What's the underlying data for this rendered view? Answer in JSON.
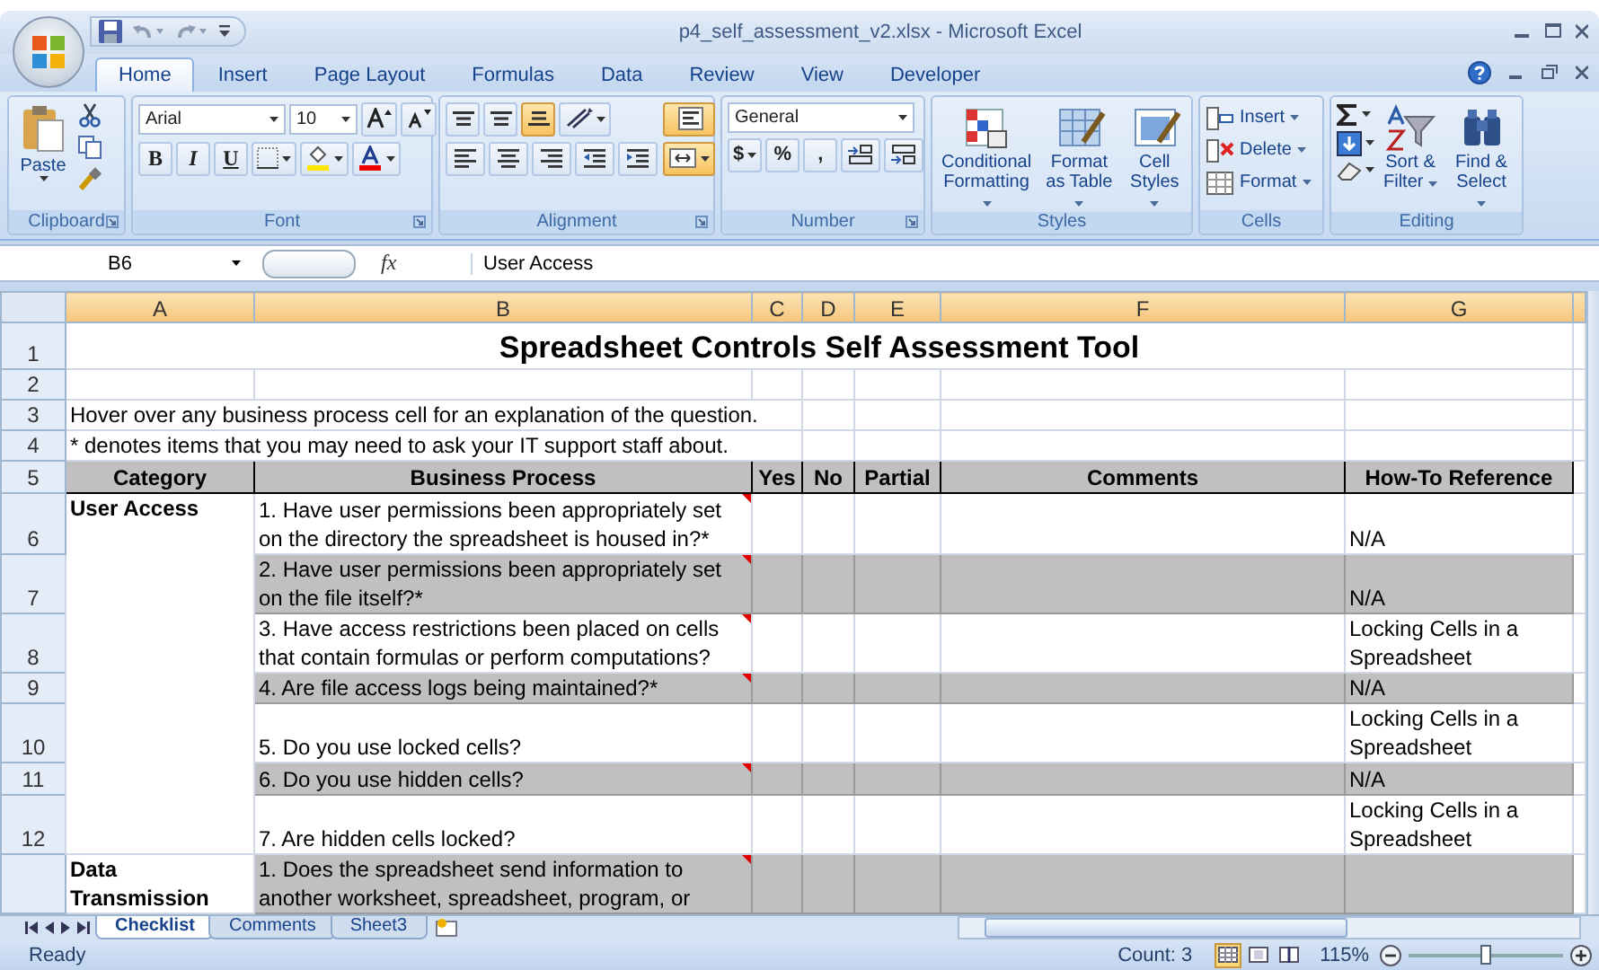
{
  "title_bar": {
    "title": "p4_self_assessment_v2.xlsx - Microsoft Excel"
  },
  "ribbon_tabs": [
    {
      "label": "Home",
      "selected": true
    },
    {
      "label": "Insert",
      "selected": false
    },
    {
      "label": "Page Layout",
      "selected": false
    },
    {
      "label": "Formulas",
      "selected": false
    },
    {
      "label": "Data",
      "selected": false
    },
    {
      "label": "Review",
      "selected": false
    },
    {
      "label": "View",
      "selected": false
    },
    {
      "label": "Developer",
      "selected": false
    }
  ],
  "clipboard": {
    "label": "Clipboard",
    "paste": "Paste"
  },
  "font": {
    "label": "Font",
    "name": "Arial",
    "size": "10",
    "buttons": [
      {
        "kind": "bold",
        "text": "B"
      },
      {
        "kind": "italic",
        "text": "I"
      },
      {
        "kind": "underline",
        "text": "U"
      }
    ]
  },
  "alignment": {
    "label": "Alignment",
    "buttons": [
      {
        "kind": "align-top",
        "selected": false
      },
      {
        "kind": "align-middle",
        "selected": false
      },
      {
        "kind": "align-bottom",
        "selected": true
      },
      {
        "kind": "orientation",
        "selected": false
      },
      {
        "kind": "wrap-text",
        "selected": true
      },
      {
        "kind": "align-left",
        "selected": false
      },
      {
        "kind": "align-center",
        "selected": false
      },
      {
        "kind": "align-right",
        "selected": false
      },
      {
        "kind": "decrease-indent",
        "selected": false
      },
      {
        "kind": "increase-indent",
        "selected": false
      },
      {
        "kind": "merge-center",
        "selected": true
      }
    ]
  },
  "number": {
    "label": "Number",
    "format": "General",
    "symbols": [
      "$",
      "%",
      ","
    ]
  },
  "styles": {
    "label": "Styles",
    "buttons": [
      {
        "kind": "conditional",
        "lines": [
          "Conditional",
          "Formatting"
        ]
      },
      {
        "kind": "table",
        "lines": [
          "Format",
          "as Table"
        ]
      },
      {
        "kind": "cell-styles",
        "lines": [
          "Cell",
          "Styles"
        ]
      }
    ]
  },
  "cells": {
    "label": "Cells",
    "buttons": [
      {
        "kind": "insert",
        "text": "Insert"
      },
      {
        "kind": "delete",
        "text": "Delete"
      },
      {
        "kind": "format",
        "text": "Format"
      }
    ]
  },
  "editing": {
    "label": "Editing",
    "buttons": [
      {
        "kind": "sort",
        "lines": [
          "Sort &",
          "Filter"
        ]
      },
      {
        "kind": "find",
        "lines": [
          "Find &",
          "Select"
        ]
      }
    ]
  },
  "formula_bar": {
    "cell_ref": "B6",
    "function_label": "fx",
    "value": "User Access"
  },
  "columns": [
    "A",
    "B",
    "C",
    "D",
    "E",
    "F",
    "G"
  ],
  "rows": [
    {
      "number": "1",
      "kind": "title",
      "text": "Spreadsheet Controls Self Assessment Tool"
    },
    {
      "number": "2",
      "kind": "blank"
    },
    {
      "number": "3",
      "kind": "note",
      "text": "Hover over any business process cell for an explanation of the question."
    },
    {
      "number": "4",
      "kind": "note",
      "text": "* denotes items that you may need to ask your IT support staff about."
    },
    {
      "number": "5",
      "kind": "header",
      "cells": [
        "Category",
        "Business Process",
        "Yes",
        "No",
        "Partial",
        "Comments",
        "How-To Reference"
      ]
    },
    {
      "number": "6",
      "kind": "item",
      "category": "User Access",
      "process": "1. Have user permissions been appropriately set on the directory the spreadsheet is housed in?*",
      "comment": true,
      "shaded": false,
      "reference": "N/A"
    },
    {
      "number": "7",
      "kind": "item",
      "process": "2. Have user permissions been appropriately set on the file itself?*",
      "comment": true,
      "shaded": true,
      "reference": "N/A"
    },
    {
      "number": "8",
      "kind": "item",
      "process": "3. Have access restrictions been placed on cells that contain formulas or perform computations?",
      "comment": true,
      "shaded": false,
      "reference": "Locking Cells in a Spreadsheet"
    },
    {
      "number": "9",
      "kind": "item",
      "process": "4. Are file access logs being maintained?*",
      "comment": true,
      "shaded": true,
      "reference": "N/A"
    },
    {
      "number": "10",
      "kind": "item",
      "process": "5. Do you use locked cells?",
      "comment": false,
      "shaded": false,
      "reference": "Locking Cells in a Spreadsheet"
    },
    {
      "number": "11",
      "kind": "item",
      "process": "6. Do you use hidden cells?",
      "comment": true,
      "shaded": true,
      "reference": "N/A"
    },
    {
      "number": "12",
      "kind": "item",
      "process": "7. Are hidden cells locked?",
      "comment": false,
      "shaded": false,
      "reference": "Locking Cells in a Spreadsheet"
    },
    {
      "kind": "item",
      "category": "Data Transmission",
      "process": "1. Does the spreadsheet send information to another worksheet, spreadsheet, program, or",
      "comment": true,
      "shaded": true
    }
  ],
  "sheet_tabs": [
    {
      "label": "Checklist",
      "selected": true
    },
    {
      "label": "Comments",
      "selected": false
    },
    {
      "label": "Sheet3",
      "selected": false
    }
  ],
  "status_bar": {
    "mode": "Ready",
    "count": "Count: 3",
    "zoom": "115%",
    "zoom_slider": {
      "level": 0.5
    },
    "views": [
      {
        "kind": "normal",
        "selected": true
      },
      {
        "kind": "page-layout",
        "selected": false
      },
      {
        "kind": "page-break",
        "selected": false
      }
    ]
  }
}
